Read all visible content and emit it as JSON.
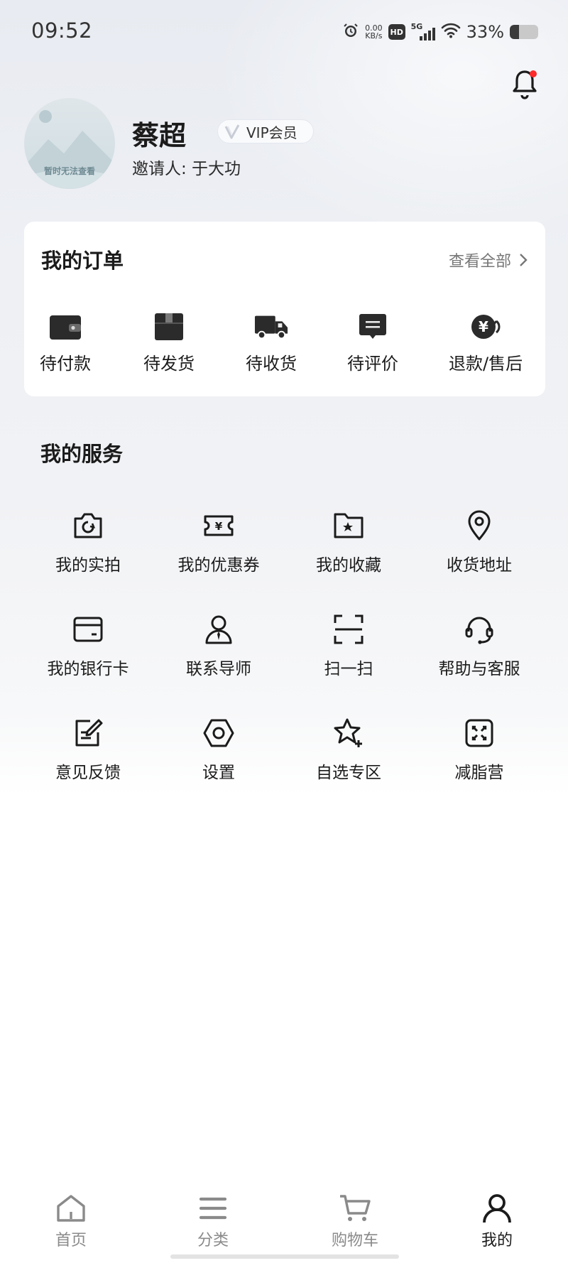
{
  "status_bar": {
    "time": "09:52",
    "net_speed_value": "0.00",
    "net_speed_unit": "KB/s",
    "hd_label": "HD",
    "signal_label": "5G",
    "battery_percent": "33%",
    "battery_level": 0.33
  },
  "profile": {
    "avatar_caption": "暂时无法查看",
    "name": "蔡超",
    "vip_label": "VIP会员",
    "inviter": "邀请人: 于大功",
    "notification_dot_color": "#ff2a2a"
  },
  "orders": {
    "title": "我的订单",
    "view_all": "查看全部",
    "items": [
      {
        "label": "待付款",
        "icon": "wallet-icon"
      },
      {
        "label": "待发货",
        "icon": "package-icon"
      },
      {
        "label": "待收货",
        "icon": "truck-icon"
      },
      {
        "label": "待评价",
        "icon": "comment-icon"
      },
      {
        "label": "退款/售后",
        "icon": "refund-icon"
      }
    ]
  },
  "services": {
    "title": "我的服务",
    "items": [
      {
        "label": "我的实拍",
        "icon": "camera-icon"
      },
      {
        "label": "我的优惠券",
        "icon": "coupon-icon"
      },
      {
        "label": "我的收藏",
        "icon": "favorites-folder-icon"
      },
      {
        "label": "收货地址",
        "icon": "location-pin-icon"
      },
      {
        "label": "我的银行卡",
        "icon": "bank-card-icon"
      },
      {
        "label": "联系导师",
        "icon": "mentor-icon"
      },
      {
        "label": "扫一扫",
        "icon": "scan-icon"
      },
      {
        "label": "帮助与客服",
        "icon": "headset-icon"
      },
      {
        "label": "意见反馈",
        "icon": "feedback-icon"
      },
      {
        "label": "设置",
        "icon": "settings-icon"
      },
      {
        "label": "自选专区",
        "icon": "star-plus-icon"
      },
      {
        "label": "减脂营",
        "icon": "fat-loss-icon"
      }
    ]
  },
  "bottom_nav": {
    "tabs": [
      {
        "label": "首页",
        "icon": "home-icon",
        "active": false
      },
      {
        "label": "分类",
        "icon": "menu-icon",
        "active": false
      },
      {
        "label": "购物车",
        "icon": "cart-icon",
        "active": false
      },
      {
        "label": "我的",
        "icon": "profile-icon",
        "active": true
      }
    ]
  },
  "colors": {
    "text_primary": "#1b1b1b",
    "text_secondary": "#777777",
    "nav_inactive": "#8a8a8a",
    "notification_dot": "#ff2a2a"
  }
}
